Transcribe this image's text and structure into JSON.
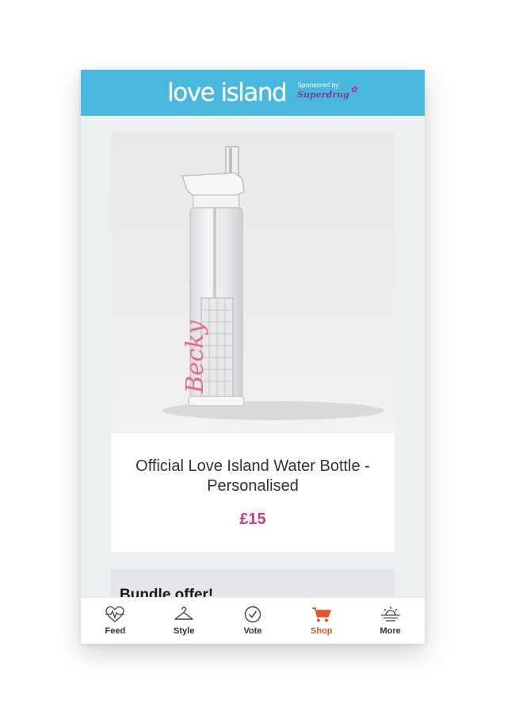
{
  "header": {
    "logo_text": "love island",
    "sponsor_label": "Sponsored by",
    "sponsor_brand": "Superdrug",
    "bg_color": "#49b8de"
  },
  "product": {
    "title": "Official Love Island Water Bottle - Personalised",
    "price": "£15",
    "price_color": "#d5367d",
    "bottle_text": "Becky"
  },
  "next_card": {
    "title": "Bundle offer!"
  },
  "tabbar": {
    "active_color": "#e8552b",
    "items": [
      {
        "label": "Feed",
        "icon": "heartbeat-icon"
      },
      {
        "label": "Style",
        "icon": "hanger-icon"
      },
      {
        "label": "Vote",
        "icon": "check-circle-icon"
      },
      {
        "label": "Shop",
        "icon": "cart-icon"
      },
      {
        "label": "More",
        "icon": "sunset-icon"
      }
    ]
  }
}
